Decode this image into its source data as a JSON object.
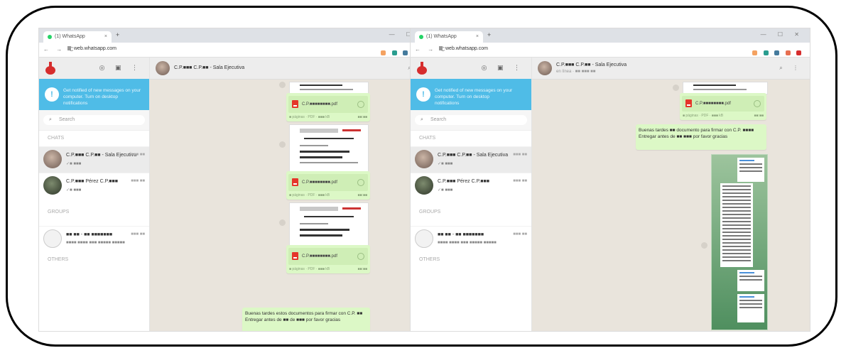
{
  "left": {
    "browser": {
      "tab_title": "(1) WhatsApp",
      "tab_close": "×",
      "new_tab": "+",
      "window_controls": "— ☐ ✕",
      "nav": "← → C",
      "url": "web.whatsapp.com"
    },
    "notification": {
      "icon": "!",
      "text": "Get notified of new messages on your computer. Turn on desktop notifications"
    },
    "search_placeholder": "Search",
    "sections": [
      "CHATS",
      "GROUPS",
      "OTHERS"
    ],
    "chats": [
      {
        "name": "C.P.■■■ C.P.■■ - Sala Ejecutiva",
        "time": "■■■ ■■",
        "preview": "✓■ ■■■"
      },
      {
        "name": "C.P.■■■ Pérez C.P.■■■",
        "time": "■■■ ■■",
        "preview": "✓■ ■■■"
      },
      {
        "name": "■■ ■■ - ■■ ■■■■■■■",
        "time": "■■■ ■■",
        "preview": "■■■■ ■■■■ ■■■ ■■■■■ ■■■■■"
      }
    ],
    "conversation": {
      "title": "C.P.■■■ C.P.■■ - Sala Ejecutiva",
      "files": [
        "C.P.■■■■■■■■.pdf",
        "C.P.■■■■■■■■.pdf",
        "C.P.■■■■■■■■.pdf"
      ],
      "file_meta": "■ páginas · PDF · ■■■ kB",
      "time": "■■:■■",
      "text_message": "Buenas tardes estos documentos para firmar con C.P. ■■ Entregar antes de ■■ de ■■■ por favor gracias"
    }
  },
  "right": {
    "browser": {
      "tab_title": "(1) WhatsApp",
      "tab_close": "×",
      "new_tab": "+",
      "window_controls": "— ☐ ✕",
      "nav": "← → C",
      "url": "web.whatsapp.com"
    },
    "notification": {
      "icon": "!",
      "text": "Get notified of new messages on your computer. Turn on desktop notifications"
    },
    "search_placeholder": "Search",
    "sections": [
      "CHATS",
      "GROUPS",
      "OTHERS"
    ],
    "chats": [
      {
        "name": "C.P.■■■ C.P.■■ - Sala Ejecutiva",
        "time": "■■■ ■■",
        "preview": "✓■ ■■■"
      },
      {
        "name": "C.P.■■■ Pérez C.P.■■■",
        "time": "■■■ ■■",
        "preview": "✓■ ■■■"
      },
      {
        "name": "■■ ■■ - ■■ ■■■■■■■",
        "time": "■■■ ■■",
        "preview": "■■■■ ■■■■ ■■■ ■■■■■ ■■■■■"
      }
    ],
    "conversation": {
      "title": "C.P.■■■ C.P.■■ - Sala Ejecutiva",
      "subtitle": "en línea · ■■ ■■■ ■■",
      "files": [
        "C.P.■■■■■■■■.pdf"
      ],
      "file_meta": "■ páginas · PDF · ■■■ kB",
      "time": "■■:■■",
      "text_message": "Buenas tardes ■■ documento para firmar con C.P. ■■■■ Entregar antes de ■■ ■■■ por favor gracias"
    }
  },
  "colors": {
    "notification_bg": "#4fbce7",
    "outgoing_bubble": "#dcf8c6",
    "chat_bg": "#e9e4dc",
    "pdf_icon": "#e5362a",
    "frame_border": "#000000"
  }
}
